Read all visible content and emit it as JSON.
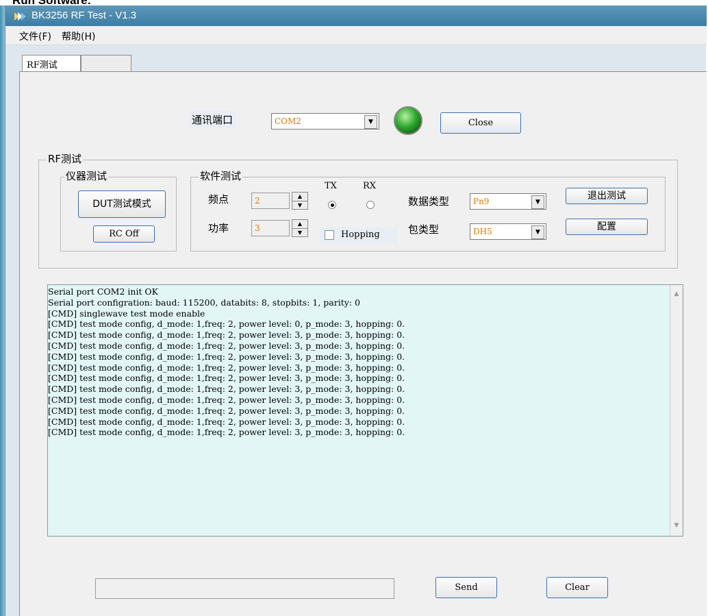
{
  "caption": "Run Software:",
  "window": {
    "title": "BK3256 RF Test - V1.3"
  },
  "menu": [
    "文件(F)",
    "帮助(H)"
  ],
  "tabs": [
    "RF测试",
    ""
  ],
  "com": {
    "label": "通讯端口",
    "value": "COM2",
    "close_label": "Close",
    "led_color": "#2ea82e"
  },
  "rf_group": {
    "title": "RF测试"
  },
  "instrument": {
    "title": "仪器测试",
    "dut_label": "DUT测试模式",
    "rc_label": "RC Off"
  },
  "software": {
    "title": "软件测试",
    "freq_label": "频点",
    "freq_value": "2",
    "power_label": "功率",
    "power_value": "3",
    "tx_label": "TX",
    "rx_label": "RX",
    "hopping_label": "Hopping",
    "data_type_label": "数据类型",
    "data_type_value": "Pn9",
    "packet_type_label": "包类型",
    "packet_type_value": "DH5",
    "exit_label": "退出测试",
    "config_label": "配置"
  },
  "log": [
    "Serial port COM2 init OK",
    "Serial port configration: baud: 115200, databits: 8, stopbits: 1, parity: 0",
    "[CMD] singlewave test mode enable",
    "[CMD] test mode config, d_mode: 1,freq: 2, power level: 0, p_mode: 3, hopping: 0.",
    "[CMD] test mode config, d_mode: 1,freq: 2, power level: 3, p_mode: 3, hopping: 0.",
    "[CMD] test mode config, d_mode: 1,freq: 2, power level: 3, p_mode: 3, hopping: 0.",
    "[CMD] test mode config, d_mode: 1,freq: 2, power level: 3, p_mode: 3, hopping: 0.",
    "[CMD] test mode config, d_mode: 1,freq: 2, power level: 3, p_mode: 3, hopping: 0.",
    "[CMD] test mode config, d_mode: 1,freq: 2, power level: 3, p_mode: 3, hopping: 0.",
    "[CMD] test mode config, d_mode: 1,freq: 2, power level: 3, p_mode: 3, hopping: 0.",
    "[CMD] test mode config, d_mode: 1,freq: 2, power level: 3, p_mode: 3, hopping: 0.",
    "[CMD] test mode config, d_mode: 1,freq: 2, power level: 3, p_mode: 3, hopping: 0.",
    "[CMD] test mode config, d_mode: 1,freq: 2, power level: 3, p_mode: 3, hopping: 0.",
    "[CMD] test mode config, d_mode: 1,freq: 2, power level: 3, p_mode: 3, hopping: 0."
  ],
  "send": {
    "input_value": "",
    "send_label": "Send",
    "clear_label": "Clear"
  },
  "icons": [
    "app-icon",
    "led-indicator",
    "dropdown-arrow-icon",
    "spin-up-icon",
    "spin-down-icon",
    "scroll-up-icon",
    "scroll-down-icon"
  ]
}
